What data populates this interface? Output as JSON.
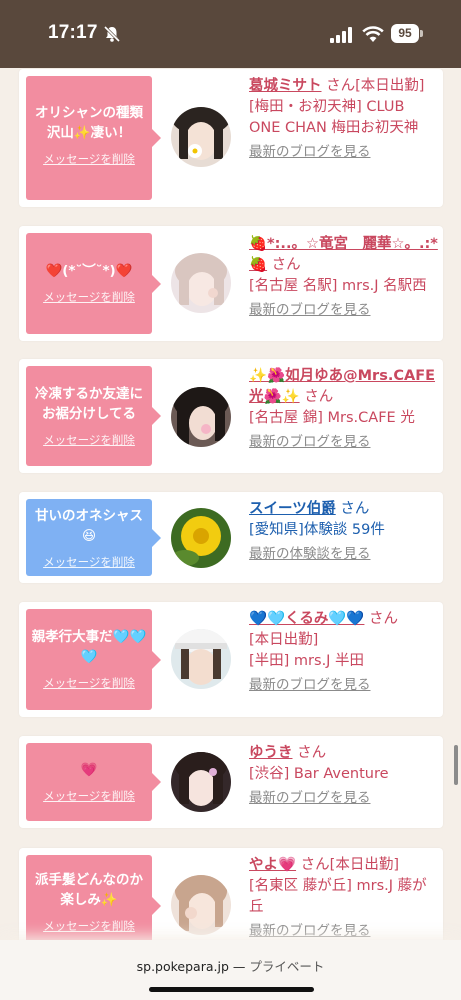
{
  "status": {
    "time": "17:17",
    "battery": "95"
  },
  "items": [
    {
      "message": "オリシャンの種類沢山✨凄い！",
      "bubble_color": "pink",
      "name": "葛城ミサト",
      "san": "さん",
      "tag": "[本日出勤]",
      "store": "[梅田・お初天神] CLUB ONE CHAN 梅田お初天神",
      "link": "最新のブログを見る",
      "avatar": "a1"
    },
    {
      "message": "❤️(*˘︶˘*)❤️",
      "bubble_color": "pink",
      "name": "🍓*:..。☆竜宮　麗華☆。.:*🍓",
      "san": "さん",
      "tag": "",
      "store": "[名古屋 名駅] mrs.J 名駅西",
      "link": "最新のブログを見る",
      "avatar": "a2"
    },
    {
      "message": "冷凍するか友達にお裾分けしてる",
      "bubble_color": "pink",
      "name": "✨🌺如月ゆあ@Mrs.CAFE光🌺✨",
      "san": "さん",
      "tag": "",
      "store": "[名古屋 錦] Mrs.CAFE 光",
      "link": "最新のブログを見る",
      "avatar": "a3"
    },
    {
      "message": "甘いのオネシャス😆",
      "bubble_color": "blue",
      "name": "スイーツ伯爵",
      "san": "さん",
      "tag": "",
      "store": "[愛知県]体験談 59件",
      "link": "最新の体験談を見る",
      "avatar": "a4"
    },
    {
      "message": "親孝行大事だ🩵🩵🩵",
      "bubble_color": "pink",
      "name": "💙🩵くるみ🩵💙",
      "san": "さん",
      "tag": "[本日出勤]",
      "store": "[半田] mrs.J 半田",
      "link": "最新のブログを見る",
      "avatar": "a5"
    },
    {
      "message": "💗",
      "bubble_color": "pink",
      "name": "ゆうき",
      "san": "さん",
      "tag": "",
      "store": "[渋谷] Bar Aventure",
      "link": "最新のブログを見る",
      "avatar": "a6"
    },
    {
      "message": "派手髪どんなのか楽しみ✨",
      "bubble_color": "pink",
      "name": "やよ💗",
      "san": "さん",
      "tag": "[本日出勤]",
      "store": "[名東区 藤が丘] mrs.J 藤が丘",
      "link": "最新のブログを見る",
      "avatar": "a7"
    }
  ],
  "delete_label": "メッセージを削除",
  "browser": {
    "domain": "sp.pokepara.jp",
    "separator": "—",
    "mode": "プライベート"
  },
  "colors": {
    "header": "#59483c",
    "pink_bubble": "#f28da0",
    "blue_bubble": "#7fb1f3",
    "cast_text": "#c9485f",
    "user_text": "#1d5fae"
  }
}
